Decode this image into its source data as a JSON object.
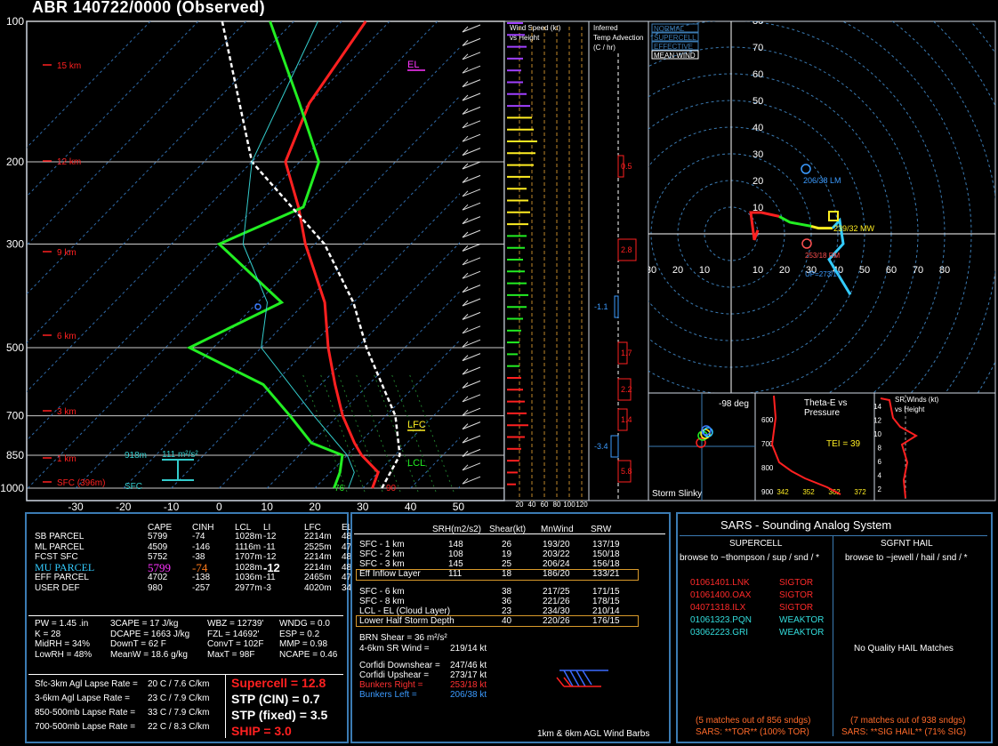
{
  "title": "ABR   140722/0000  (Observed)",
  "skewt": {
    "pressure_labels": [
      "100",
      "200",
      "300",
      "500",
      "700",
      "850",
      "1000"
    ],
    "temp_labels": [
      "-30",
      "-20",
      "-10",
      "0",
      "10",
      "20",
      "30",
      "40",
      "50"
    ],
    "height_labels": [
      "15 km",
      "12 km",
      "9 km",
      "6 km",
      "3 km",
      "1 km",
      "SFC (396m)"
    ],
    "el_label": "EL",
    "lfc_label": "LFC",
    "lcl_label": "LCL",
    "pcl_918": "918m",
    "srh_mark": "111 m²/s²",
    "sfc_label": "SFC",
    "td_sfc": "76",
    "t_sfc": "90"
  },
  "wind_speed": {
    "title": "Wind Speed (kt)",
    "subtitle": "vs Height",
    "ticks": [
      "20",
      "40",
      "60",
      "80",
      "100",
      "120"
    ]
  },
  "temp_adv": {
    "title": "Inferred Temp Advection (C / hr)",
    "values": [
      "0.5",
      "2.8",
      "-1.1",
      "1.7",
      "2.2",
      "1.4",
      "-3.4",
      "5.8"
    ]
  },
  "hodograph": {
    "legend": [
      "NORMAL",
      "SUPERCELL",
      "EFFECTIVE",
      "MEAN WIND"
    ],
    "ring_labels": [
      "10",
      "20",
      "30",
      "40",
      "50",
      "60",
      "70",
      "80"
    ],
    "axis_labels": [
      "40",
      "30",
      "20",
      "10",
      "10",
      "20",
      "30",
      "40",
      "50",
      "60",
      "70",
      "80"
    ],
    "lm_label": "206/38 LM",
    "rm_label": "253/18 RM",
    "mw_label": "239/32 MW",
    "up_label": "UP=273/17"
  },
  "storm_slinky": {
    "label": "Storm Slinky",
    "deg": "-98 deg"
  },
  "theta_e": {
    "title": "Theta-E vs Pressure",
    "tei": "TEI = 39",
    "p_ticks": [
      "600",
      "700",
      "800",
      "900"
    ],
    "x_ticks": [
      "342",
      "352",
      "362",
      "372"
    ]
  },
  "sr_winds": {
    "title": "SR Winds (kt) vs Height",
    "h_ticks": [
      "14",
      "12",
      "10",
      "8",
      "6",
      "4",
      "2"
    ]
  },
  "parcels": {
    "columns": [
      "CAPE",
      "CINH",
      "LCL",
      "LI",
      "LFC",
      "EL"
    ],
    "rows": [
      {
        "name": "SB PARCEL",
        "cape": "5799",
        "cinh": "-74",
        "lcl": "1028m",
        "li": "-12",
        "lfc": "2214m",
        "el": "48464'"
      },
      {
        "name": "ML PARCEL",
        "cape": "4509",
        "cinh": "-146",
        "lcl": "1116m",
        "li": "-11",
        "lfc": "2525m",
        "el": "47849'"
      },
      {
        "name": "FCST SFC",
        "cape": "5752",
        "cinh": "-38",
        "lcl": "1707m",
        "li": "-12",
        "lfc": "2214m",
        "el": "48464'"
      },
      {
        "name": "MU PARCEL",
        "cape": "5799",
        "cinh": "-74",
        "lcl": "1028m",
        "li": "-12",
        "lfc": "2214m",
        "el": "48464'"
      },
      {
        "name": "EFF PARCEL",
        "cape": "4702",
        "cinh": "-138",
        "lcl": "1036m",
        "li": "-11",
        "lfc": "2465m",
        "el": "47684'"
      },
      {
        "name": "USER DEF",
        "cape": "980",
        "cinh": "-257",
        "lcl": "2977m",
        "li": "-3",
        "lfc": "4020m",
        "el": "34867'"
      }
    ],
    "indices": [
      [
        "PW = 1.45 .in",
        "3CAPE = 17 J/kg",
        "WBZ = 12739'",
        "WNDG = 0.0"
      ],
      [
        "K = 28",
        "DCAPE = 1663 J/kg",
        "FZL = 14692'",
        "ESP = 0.2"
      ],
      [
        "MidRH = 34%",
        "DownT = 62 F",
        "ConvT = 102F",
        "MMP = 0.98"
      ],
      [
        "LowRH = 48%",
        "MeanW = 18.6 g/kg",
        "MaxT = 98F",
        "NCAPE = 0.46"
      ]
    ],
    "lapse": [
      [
        "Sfc-3km Agl Lapse Rate =",
        "20 C / 7.6 C/km"
      ],
      [
        "3-6km Agl Lapse Rate =",
        "23 C / 7.9 C/km"
      ],
      [
        "850-500mb Lapse Rate =",
        "33 C / 7.9 C/km"
      ],
      [
        "700-500mb Lapse Rate =",
        "22 C / 8.3 C/km"
      ]
    ],
    "composites": {
      "supercell": "Supercell = 12.8",
      "stp_cin": "STP (CIN) = 0.7",
      "stp_fixed": "STP (fixed) = 3.5",
      "ship": "SHIP = 3.0"
    }
  },
  "kinematics": {
    "columns": [
      "SRH(m2/s2)",
      "Shear(kt)",
      "MnWind",
      "SRW"
    ],
    "rows": [
      {
        "name": "SFC - 1 km",
        "srh": "148",
        "shear": "26",
        "mnwind": "193/20",
        "srw": "137/19"
      },
      {
        "name": "SFC - 2 km",
        "srh": "108",
        "shear": "19",
        "mnwind": "203/22",
        "srw": "150/18"
      },
      {
        "name": "SFC - 3 km",
        "srh": "145",
        "shear": "25",
        "mnwind": "206/24",
        "srw": "156/18"
      },
      {
        "name": "Eff Inflow Layer",
        "srh": "111",
        "shear": "18",
        "mnwind": "186/20",
        "srw": "133/21"
      },
      {
        "name": "SFC - 6 km",
        "srh": "",
        "shear": "38",
        "mnwind": "217/25",
        "srw": "171/15"
      },
      {
        "name": "SFC - 8 km",
        "srh": "",
        "shear": "36",
        "mnwind": "221/26",
        "srw": "178/15"
      },
      {
        "name": "LCL - EL (Cloud Layer)",
        "srh": "",
        "shear": "23",
        "mnwind": "234/30",
        "srw": "210/14"
      },
      {
        "name": "Lower Half Storm Depth",
        "srh": "",
        "shear": "40",
        "mnwind": "220/26",
        "srw": "176/15"
      }
    ],
    "brn": "BRN Shear = 36 m²/s²",
    "sr46": [
      "4-6km SR Wind =",
      "219/14 kt"
    ],
    "corfidi_down": [
      "Corfidi Downshear =",
      "247/46 kt"
    ],
    "corfidi_up": [
      "Corfidi Upshear =",
      "273/17 kt"
    ],
    "bunkers_right": [
      "Bunkers Right =",
      "253/18 kt"
    ],
    "bunkers_left": [
      "Bunkers Left =",
      "206/38 kt"
    ],
    "barbs_label": "1km & 6km AGL Wind Barbs"
  },
  "sars": {
    "title": "SARS - Sounding Analog System",
    "supercell_header": "SUPERCELL",
    "hail_header": "SGFNT HAIL",
    "supercell_browse": "browse to ~thompson / sup / snd / *",
    "hail_browse": "browse to ~jewell / hail / snd / *",
    "matches": [
      {
        "id": "01061401.LNK",
        "type": "SIGTOR",
        "color": "#ff2a2a"
      },
      {
        "id": "01061400.OAX",
        "type": "SIGTOR",
        "color": "#ff2a2a"
      },
      {
        "id": "04071318.ILX",
        "type": "SIGTOR",
        "color": "#ff2a2a"
      },
      {
        "id": "01061323.PQN",
        "type": "WEAKTOR",
        "color": "#33dddd"
      },
      {
        "id": "03062223.GRI",
        "type": "WEAKTOR",
        "color": "#33dddd"
      }
    ],
    "no_hail": "No Quality HAIL Matches",
    "sup_count": "(5 matches out of 856 sndgs)",
    "sup_summary": "SARS:  **TOR** (100% TOR)",
    "hail_count": "(7 matches out of 938 sndgs)",
    "hail_summary": "SARS:  **SIG HAIL** (71% SIG)"
  },
  "colors": {
    "temp": "#ff2020",
    "dew": "#22ee22",
    "parcel": "#ffffff",
    "frame": "#3b7bb3",
    "cyan": "#33ccff",
    "orange": "#d99a2b"
  },
  "chart_data": {
    "type": "line",
    "title": "ABR   140722/0000  (Observed)",
    "xlabel": "",
    "ylabel": "",
    "xlim": [
      -30,
      50
    ],
    "ylim": [
      1000,
      100
    ],
    "series": [
      {
        "name": "",
        "values": [
          [
            1000,
            32
          ],
          [
            925,
            30
          ],
          [
            850,
            23
          ],
          [
            800,
            19
          ],
          [
            700,
            11
          ],
          [
            600,
            3
          ],
          [
            500,
            -6
          ],
          [
            400,
            -16
          ],
          [
            300,
            -32
          ],
          [
            250,
            -41
          ],
          [
            200,
            -53
          ],
          [
            150,
            -60
          ],
          [
            100,
            -65
          ]
        ]
      },
      {
        "name": "",
        "values": [
          [
            1000,
            24
          ],
          [
            925,
            22
          ],
          [
            850,
            19
          ],
          [
            800,
            10
          ],
          [
            700,
            0
          ],
          [
            600,
            -12
          ],
          [
            500,
            -35
          ],
          [
            400,
            -25
          ],
          [
            300,
            -50
          ],
          [
            250,
            -40
          ],
          [
            200,
            -46
          ],
          [
            150,
            -62
          ],
          [
            100,
            -85
          ]
        ]
      }
    ]
  }
}
